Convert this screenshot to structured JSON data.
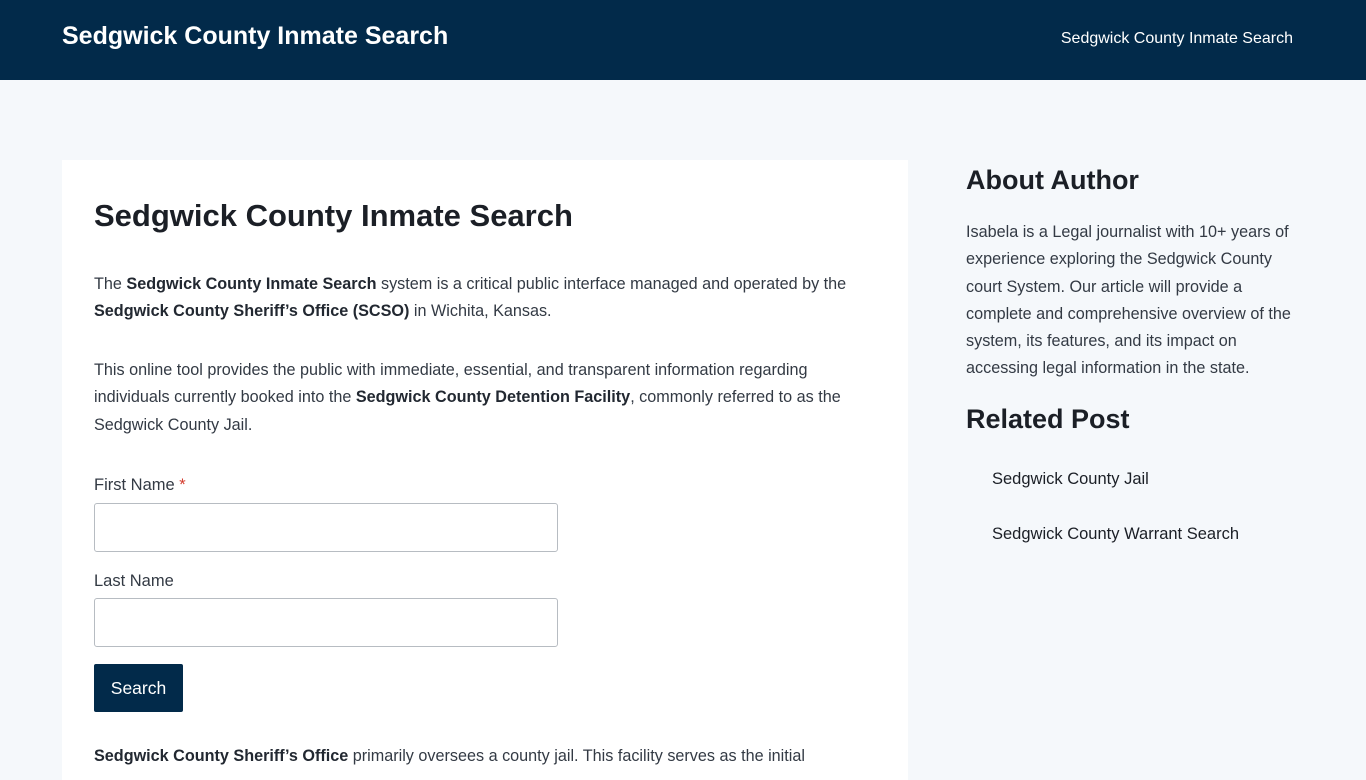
{
  "header": {
    "site_title": "Sedgwick County Inmate Search",
    "nav_link": "Sedgwick County Inmate Search"
  },
  "main": {
    "title": "Sedgwick County Inmate Search",
    "p1": {
      "t1": "The ",
      "b1": "Sedgwick County Inmate Search",
      "t2": " system is a critical public interface managed and operated by the ",
      "b2": "Sedgwick County Sheriff’s Office (SCSO)",
      "t3": " in Wichita, Kansas."
    },
    "p2": {
      "t1": "This online tool provides the public with immediate, essential, and transparent information regarding individuals currently booked into the ",
      "b1": "Sedgwick County Detention Facility",
      "t2": ", commonly referred to as the Sedgwick County Jail."
    },
    "form": {
      "first_name_label": "First Name",
      "required_mark": "*",
      "first_name_value": "",
      "last_name_label": "Last Name",
      "last_name_value": "",
      "search_label": "Search"
    },
    "p3": {
      "b1": "Sedgwick County Sheriff’s Office",
      "t1": " primarily oversees a county jail. This facility serves as the initial"
    }
  },
  "sidebar": {
    "about_heading": "About Author",
    "about_text": "Isabela is a Legal journalist with 10+ years of experience exploring the Sedgwick County court System. Our article will provide a complete and comprehensive overview of the system, its features, and its impact on accessing legal information in the state.",
    "related_heading": "Related Post",
    "related": [
      {
        "label": "Sedgwick County Jail"
      },
      {
        "label": "Sedgwick County Warrant Search"
      }
    ]
  },
  "colors": {
    "header_bg": "#022a4a",
    "page_bg": "#f5f8fb",
    "required": "#d33a2c"
  }
}
